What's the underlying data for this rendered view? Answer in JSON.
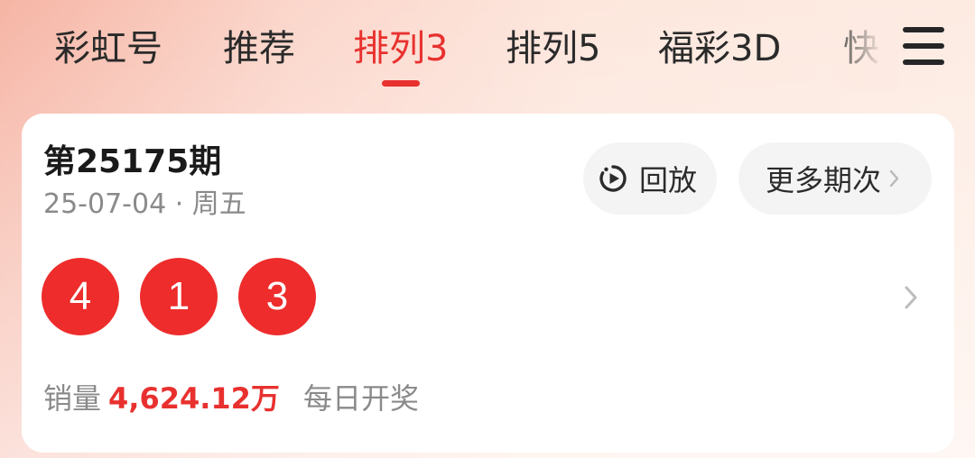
{
  "tabs": [
    {
      "label": "彩虹号",
      "active": false
    },
    {
      "label": "推荐",
      "active": false
    },
    {
      "label": "排列3",
      "active": true
    },
    {
      "label": "排列5",
      "active": false
    },
    {
      "label": "福彩3D",
      "active": false
    },
    {
      "label": "快",
      "active": false
    }
  ],
  "menu_icon": "hamburger-menu-icon",
  "card": {
    "issue_title": "第25175期",
    "issue_date": "25-07-04 · 周五",
    "replay_label": "回放",
    "replay_icon": "replay-play-icon",
    "more_label": "更多期次",
    "balls": [
      "4",
      "1",
      "3"
    ],
    "sales_label": "销量",
    "sales_value": "4,624.12万",
    "schedule": "每日开奖"
  },
  "colors": {
    "accent": "#e8312f",
    "ball": "#ee2c2c",
    "card_bg": "#ffffff",
    "pill_bg": "#f4f4f4",
    "muted_text": "#8a8a8a"
  }
}
